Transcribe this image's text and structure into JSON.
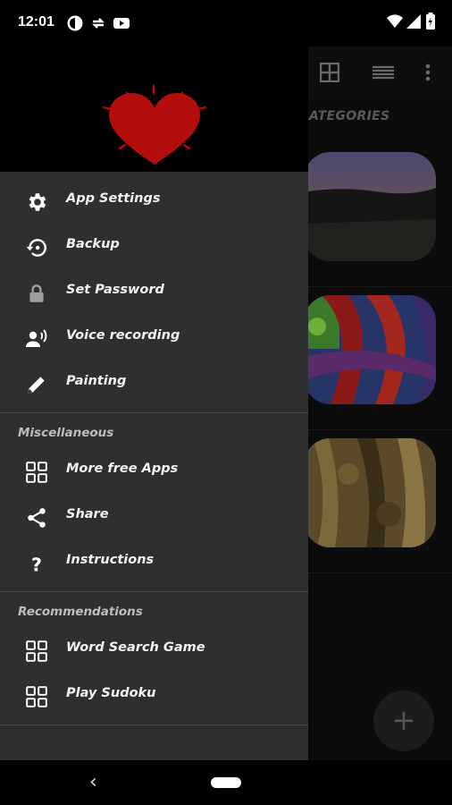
{
  "status_bar": {
    "time": "12:01",
    "notification_icons": [
      "mobile-data-icon",
      "sync-icon",
      "youtube-icon"
    ],
    "system_icons": [
      "wifi-icon",
      "cell-signal-icon",
      "battery-icon"
    ]
  },
  "app_bar": {
    "icons": [
      "grid-view-icon",
      "list-view-icon",
      "more-vert-icon"
    ]
  },
  "categories": {
    "title": "ATEGORIES",
    "thumbnails": [
      "sunset-field-photo",
      "graffiti-art-photo",
      "tree-bark-photo"
    ]
  },
  "drawer": {
    "logo": "heart-icon",
    "items": [
      {
        "label": "App Settings",
        "icon": "gear-icon"
      },
      {
        "label": "Backup",
        "icon": "backup-restore-icon"
      },
      {
        "label": "Set Password",
        "icon": "lock-icon"
      },
      {
        "label": "Voice recording",
        "icon": "voice-icon"
      },
      {
        "label": "Painting",
        "icon": "pencil-icon"
      }
    ],
    "misc_header": "Miscellaneous",
    "misc_items": [
      {
        "label": "More free Apps",
        "icon": "apps-grid-icon"
      },
      {
        "label": "Share",
        "icon": "share-icon"
      },
      {
        "label": "Instructions",
        "icon": "question-icon"
      }
    ],
    "rec_header": "Recommendations",
    "rec_items": [
      {
        "label": "Word Search Game",
        "icon": "apps-grid-icon"
      },
      {
        "label": "Play Sudoku",
        "icon": "apps-grid-icon"
      }
    ]
  },
  "fab": {
    "label": "+"
  },
  "nav_bar": {
    "back": "‹"
  },
  "colors": {
    "heart": "#b30d0d",
    "drawer_bg": "#2f2f2f",
    "text": "#f2f2f2"
  }
}
